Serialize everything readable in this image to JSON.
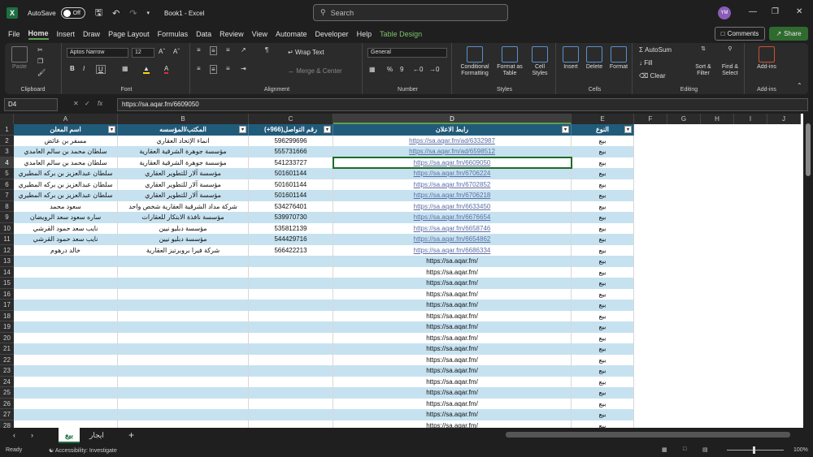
{
  "titlebar": {
    "autosave_label": "AutoSave",
    "autosave_state": "Off",
    "doc_title": "Book1  -  Excel",
    "search_placeholder": "Search",
    "avatar_initials": "YM"
  },
  "menu": {
    "items": [
      "File",
      "Home",
      "Insert",
      "Draw",
      "Page Layout",
      "Formulas",
      "Data",
      "Review",
      "View",
      "Automate",
      "Developer",
      "Help",
      "Table Design"
    ],
    "active": "Home",
    "comments_label": "Comments",
    "share_label": "Share"
  },
  "ribbon": {
    "clipboard": {
      "label": "Clipboard",
      "paste": "Paste"
    },
    "font": {
      "label": "Font",
      "family": "Aptos Narrow",
      "size": "12"
    },
    "alignment": {
      "label": "Alignment",
      "wrap": "Wrap Text",
      "merge": "Merge & Center"
    },
    "number": {
      "label": "Number",
      "format": "General"
    },
    "styles": {
      "label": "Styles",
      "cond": "Conditional Formatting",
      "fmt_table": "Format as Table",
      "cell_styles": "Cell Styles"
    },
    "cells": {
      "label": "Cells",
      "insert": "Insert",
      "delete": "Delete",
      "format": "Format"
    },
    "editing": {
      "label": "Editing",
      "autosum": "AutoSum",
      "fill": "Fill",
      "clear": "Clear",
      "sort": "Sort & Filter",
      "find": "Find & Select"
    },
    "addins": {
      "label": "Add-ins",
      "btn": "Add-ins"
    }
  },
  "formula_bar": {
    "name_box": "D4",
    "fx": "fx",
    "formula": "https://sa.aqar.fm/6609050"
  },
  "grid": {
    "columns": [
      "A",
      "B",
      "C",
      "D",
      "E",
      "F",
      "G",
      "H",
      "I",
      "J"
    ],
    "headers": {
      "a": "اسم المعلن",
      "b": "المكتب/المؤسسه",
      "c": "رقم التواصل(966+)",
      "d": "رابط الاعلان",
      "e": "النوع"
    },
    "rows": [
      {
        "n": "2",
        "a": "مسفر بن عائض",
        "b": "انماء الإتحاد العقاري",
        "c": "596299696",
        "d": "https://sa.aqar.fm/ad/6332987",
        "e": "بيع",
        "link": true
      },
      {
        "n": "3",
        "a": "سلطان محمد بن سالم العامدي",
        "b": "مؤسسة جوهرة الشرقية العقارية",
        "c": "555731666",
        "d": "https://sa.aqar.fm/ad/6598512",
        "e": "بيع",
        "link": true
      },
      {
        "n": "4",
        "a": "سلطان محمد بن سالم العامدي",
        "b": "مؤسسة جوهرة الشرقية العقارية",
        "c": "541233727",
        "d": "https://sa.aqar.fm/6609050",
        "e": "بيع",
        "link": true
      },
      {
        "n": "5",
        "a": "سلطان عبدالعزيز بن بركه المطيري",
        "b": "مؤسسة آلار للتطوير العقاري",
        "c": "501601144",
        "d": "https://sa.aqar.fm/6706224",
        "e": "بيع",
        "link": true
      },
      {
        "n": "6",
        "a": "سلطان عبدالعزيز بن بركه المطيري",
        "b": "مؤسسة آلار للتطوير العقاري",
        "c": "501601144",
        "d": "https://sa.aqar.fm/6702852",
        "e": "بيع",
        "link": true
      },
      {
        "n": "7",
        "a": "سلطان عبدالعزيز بن بركه المطيري",
        "b": "مؤسسة آلار للتطوير العقاري",
        "c": "501601144",
        "d": "https://sa.aqar.fm/6706218",
        "e": "بيع",
        "link": true
      },
      {
        "n": "8",
        "a": "سعود محمد",
        "b": "شركة مداد الشرقية العقارية شخص واحد",
        "c": "534276401",
        "d": "https://sa.aqar.fm/6633450",
        "e": "بيع",
        "link": true
      },
      {
        "n": "9",
        "a": "ساره سعود سعد الرويضان",
        "b": "مؤسسة نافذة الابتكار للعقارات",
        "c": "539970730",
        "d": "https://sa.aqar.fm/6676654",
        "e": "بيع",
        "link": true
      },
      {
        "n": "10",
        "a": "نايب سعد حمود القرشي",
        "b": "مؤسسة دبليو نيين",
        "c": "535812139",
        "d": "https://sa.aqar.fm/6658746",
        "e": "بيع",
        "link": true
      },
      {
        "n": "11",
        "a": "نايب سعد حمود القرشي",
        "b": "مؤسسة دبليو نيين",
        "c": "544429716",
        "d": "https://sa.aqar.fm/6654862",
        "e": "بيع",
        "link": true
      },
      {
        "n": "12",
        "a": "خالد درهوم",
        "b": "شركة فيرا بروبرتيز العقارية",
        "c": "566422213",
        "d": "https://sa.aqar.fm/6686334",
        "e": "بيع",
        "link": true
      },
      {
        "n": "13",
        "a": "",
        "b": "",
        "c": "",
        "d": "https://sa.aqar.fm/",
        "e": "بيع",
        "link": false
      },
      {
        "n": "14",
        "a": "",
        "b": "",
        "c": "",
        "d": "https://sa.aqar.fm/",
        "e": "بيع",
        "link": false
      },
      {
        "n": "15",
        "a": "",
        "b": "",
        "c": "",
        "d": "https://sa.aqar.fm/",
        "e": "بيع",
        "link": false
      },
      {
        "n": "16",
        "a": "",
        "b": "",
        "c": "",
        "d": "https://sa.aqar.fm/",
        "e": "بيع",
        "link": false
      },
      {
        "n": "17",
        "a": "",
        "b": "",
        "c": "",
        "d": "https://sa.aqar.fm/",
        "e": "بيع",
        "link": false
      },
      {
        "n": "18",
        "a": "",
        "b": "",
        "c": "",
        "d": "https://sa.aqar.fm/",
        "e": "بيع",
        "link": false
      },
      {
        "n": "19",
        "a": "",
        "b": "",
        "c": "",
        "d": "https://sa.aqar.fm/",
        "e": "بيع",
        "link": false
      },
      {
        "n": "20",
        "a": "",
        "b": "",
        "c": "",
        "d": "https://sa.aqar.fm/",
        "e": "بيع",
        "link": false
      },
      {
        "n": "21",
        "a": "",
        "b": "",
        "c": "",
        "d": "https://sa.aqar.fm/",
        "e": "بيع",
        "link": false
      },
      {
        "n": "22",
        "a": "",
        "b": "",
        "c": "",
        "d": "https://sa.aqar.fm/",
        "e": "بيع",
        "link": false
      },
      {
        "n": "23",
        "a": "",
        "b": "",
        "c": "",
        "d": "https://sa.aqar.fm/",
        "e": "بيع",
        "link": false
      },
      {
        "n": "24",
        "a": "",
        "b": "",
        "c": "",
        "d": "https://sa.aqar.fm/",
        "e": "بيع",
        "link": false
      },
      {
        "n": "25",
        "a": "",
        "b": "",
        "c": "",
        "d": "https://sa.aqar.fm/",
        "e": "بيع",
        "link": false
      },
      {
        "n": "26",
        "a": "",
        "b": "",
        "c": "",
        "d": "https://sa.aqar.fm/",
        "e": "بيع",
        "link": false
      },
      {
        "n": "27",
        "a": "",
        "b": "",
        "c": "",
        "d": "https://sa.aqar.fm/",
        "e": "بيع",
        "link": false
      },
      {
        "n": "28",
        "a": "",
        "b": "",
        "c": "",
        "d": "https://sa.aqar.fm/",
        "e": "بيع",
        "link": false
      }
    ],
    "selected_cell": "D4"
  },
  "sheets": {
    "tabs": [
      "بيع",
      "ايجار"
    ],
    "active": "بيع"
  },
  "status": {
    "ready": "Ready",
    "accessibility": "Accessibility: Investigate",
    "zoom": "100%"
  },
  "colors": {
    "header_fill": "#215b7a",
    "band_fill": "#c6e2f0",
    "accent": "#1d6f42"
  }
}
